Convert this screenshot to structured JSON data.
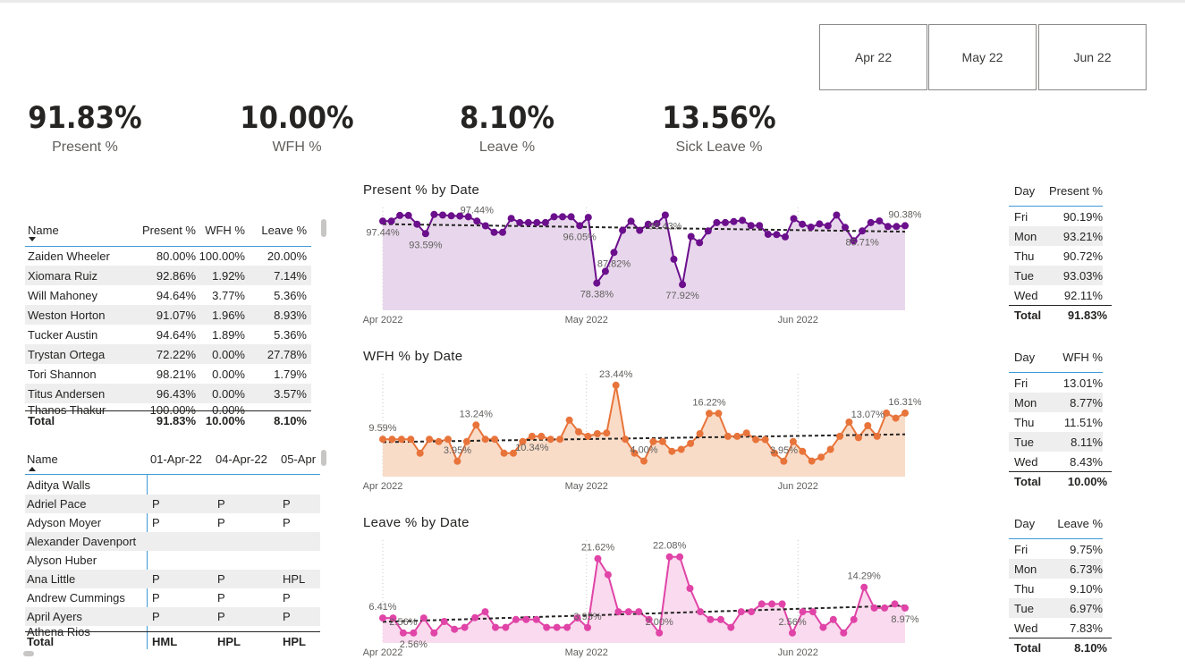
{
  "slicers": [
    "Apr 22",
    "May 22",
    "Jun 22"
  ],
  "kpis": [
    {
      "value": "91.83%",
      "label": "Present %"
    },
    {
      "value": "10.00%",
      "label": "WFH %"
    },
    {
      "value": "8.10%",
      "label": "Leave %"
    },
    {
      "value": "13.56%",
      "label": "Sick Leave %"
    }
  ],
  "employee_table": {
    "columns": [
      "Name",
      "Present %",
      "WFH %",
      "Leave %"
    ],
    "rows": [
      [
        "Zaiden Wheeler",
        "80.00%",
        "100.00%",
        "20.00%"
      ],
      [
        "Xiomara Ruiz",
        "92.86%",
        "1.92%",
        "7.14%"
      ],
      [
        "Will Mahoney",
        "94.64%",
        "3.77%",
        "5.36%"
      ],
      [
        "Weston Horton",
        "91.07%",
        "1.96%",
        "8.93%"
      ],
      [
        "Tucker Austin",
        "94.64%",
        "1.89%",
        "5.36%"
      ],
      [
        "Trystan Ortega",
        "72.22%",
        "0.00%",
        "27.78%"
      ],
      [
        "Tori Shannon",
        "98.21%",
        "0.00%",
        "1.79%"
      ],
      [
        "Titus Andersen",
        "96.43%",
        "0.00%",
        "3.57%"
      ],
      [
        "Thanos Thakur",
        "100.00%",
        "0.00%",
        ""
      ]
    ],
    "total": [
      "Total",
      "91.83%",
      "10.00%",
      "8.10%"
    ]
  },
  "attendance_matrix": {
    "columns": [
      "Name",
      "01-Apr-22",
      "04-Apr-22",
      "05-Apr"
    ],
    "rows": [
      [
        "Aditya Walls",
        "",
        "",
        ""
      ],
      [
        "Adriel Pace",
        "P",
        "P",
        "P"
      ],
      [
        "Adyson Moyer",
        "P",
        "P",
        "P"
      ],
      [
        "Alexander Davenport",
        "",
        "",
        ""
      ],
      [
        "Alyson Huber",
        "",
        "",
        ""
      ],
      [
        "Ana Little",
        "P",
        "P",
        "HPL"
      ],
      [
        "Andrew Cummings",
        "P",
        "P",
        "P"
      ],
      [
        "April Ayers",
        "P",
        "P",
        "P"
      ],
      [
        "Athena Rios",
        "",
        "",
        ""
      ]
    ],
    "total": [
      "Total",
      "HML",
      "HPL",
      "HPL"
    ]
  },
  "colors": {
    "present": "#6b0f8c",
    "present_fill": "#e8d7ec",
    "wfh": "#e8743b",
    "wfh_fill": "#f9dcc8",
    "leave": "#e044a7",
    "leave_fill": "#fadaee",
    "accent_line": "#3e9ad7"
  },
  "chart_data": [
    {
      "type": "line",
      "title": "Present % by Date",
      "x_ticks": [
        "Apr 2022",
        "May 2022",
        "Jun 2022"
      ],
      "ylim": [
        70,
        100
      ],
      "values": [
        97.44,
        97.44,
        99.2,
        99.2,
        96.5,
        93.59,
        99.5,
        99.3,
        99.1,
        99,
        98.8,
        97.44,
        96,
        94,
        94,
        98.3,
        97,
        97,
        97,
        97,
        98.8,
        98.8,
        98.8,
        96.05,
        98.6,
        78.38,
        82,
        87.82,
        94.6,
        97.4,
        94.6,
        96.5,
        96.7,
        99.3,
        85.71,
        77.92,
        92.7,
        90.8,
        94.4,
        97,
        97,
        97.3,
        97.7,
        96.1,
        96.1,
        93.4,
        93.3,
        92.6,
        98.2,
        96.5,
        95.6,
        96.6,
        96,
        99.3,
        95.5,
        91.4,
        94.4,
        97,
        97.5,
        95.8,
        95.8,
        96.05
      ],
      "labels": [
        {
          "text": "97.44%"
        },
        {
          "text": "93.59%"
        },
        {
          "text": "97.44%"
        },
        {
          "text": "87.82%"
        },
        {
          "text": "96.05%"
        },
        {
          "text": "78.38%"
        },
        {
          "text": "96.43%"
        },
        {
          "text": "77.92%"
        },
        {
          "text": "85.71%"
        },
        {
          "text": "90.38%"
        }
      ]
    },
    {
      "type": "line",
      "title": "WFH % by Date",
      "x_ticks": [
        "Apr 2022",
        "May 2022",
        "Jun 2022"
      ],
      "ylim": [
        0,
        25
      ],
      "values": [
        9.59,
        9.59,
        9.59,
        9.59,
        6.0,
        9.59,
        9.0,
        9.59,
        3.95,
        9.0,
        13.24,
        9.59,
        9.59,
        6.0,
        6.0,
        9.0,
        10.34,
        10.34,
        9.59,
        9.59,
        14.5,
        11.5,
        10.34,
        11.0,
        11.2,
        23.44,
        9.59,
        6.0,
        4.0,
        9.0,
        9.0,
        6.5,
        7.0,
        8.5,
        11.0,
        16.22,
        16.22,
        10.34,
        10.34,
        11.2,
        9.5,
        9.5,
        6.0,
        3.95,
        9.0,
        6.5,
        4.0,
        5.0,
        7.0,
        10.34,
        14.0,
        10.0,
        13.07,
        10.34,
        16.31,
        15.0,
        16.31
      ],
      "labels": [
        {
          "text": "9.59%"
        },
        {
          "text": "3.95%"
        },
        {
          "text": "13.24%"
        },
        {
          "text": "10.34%"
        },
        {
          "text": "23.44%"
        },
        {
          "text": "4.00%"
        },
        {
          "text": "16.22%"
        },
        {
          "text": "3.95%"
        },
        {
          "text": "13.07%"
        },
        {
          "text": "16.31%"
        }
      ]
    },
    {
      "type": "line",
      "title": "Leave % by Date",
      "x_ticks": [
        "Apr 2022",
        "May 2022",
        "Jun 2022"
      ],
      "ylim": [
        0,
        25
      ],
      "values": [
        6.41,
        6.41,
        2.56,
        2.56,
        6.41,
        2.56,
        5.5,
        3.5,
        4.0,
        6.5,
        8.0,
        4.0,
        4.0,
        6.0,
        6.0,
        6.0,
        4.0,
        4.0,
        4.0,
        6.41,
        3.95,
        21.62,
        17.5,
        8.0,
        8.0,
        8.0,
        6.0,
        2.56,
        22.08,
        22.08,
        14.0,
        8.0,
        6.0,
        6.0,
        4.0,
        8.0,
        8.0,
        10.0,
        10.0,
        10.0,
        2.56,
        8.0,
        8.0,
        4.0,
        6.0,
        2.56,
        6.0,
        14.29,
        8.97,
        8.97,
        10.0,
        8.97
      ],
      "labels": [
        {
          "text": "6.41%"
        },
        {
          "text": "2.56%"
        },
        {
          "text": "2.56%"
        },
        {
          "text": "3.95%"
        },
        {
          "text": "21.62%"
        },
        {
          "text": "2.00%"
        },
        {
          "text": "22.08%"
        },
        {
          "text": "2.56%"
        },
        {
          "text": "14.29%"
        },
        {
          "text": "8.97%"
        }
      ]
    }
  ],
  "day_tables": [
    {
      "columns": [
        "Day",
        "Present %"
      ],
      "rows": [
        [
          "Fri",
          "90.19%"
        ],
        [
          "Mon",
          "93.21%"
        ],
        [
          "Thu",
          "90.72%"
        ],
        [
          "Tue",
          "93.03%"
        ],
        [
          "Wed",
          "92.11%"
        ]
      ],
      "total": [
        "Total",
        "91.83%"
      ]
    },
    {
      "columns": [
        "Day",
        "WFH %"
      ],
      "rows": [
        [
          "Fri",
          "13.01%"
        ],
        [
          "Mon",
          "8.77%"
        ],
        [
          "Thu",
          "11.51%"
        ],
        [
          "Tue",
          "8.11%"
        ],
        [
          "Wed",
          "8.43%"
        ]
      ],
      "total": [
        "Total",
        "10.00%"
      ]
    },
    {
      "columns": [
        "Day",
        "Leave %"
      ],
      "rows": [
        [
          "Fri",
          "9.75%"
        ],
        [
          "Mon",
          "6.73%"
        ],
        [
          "Thu",
          "9.10%"
        ],
        [
          "Tue",
          "6.97%"
        ],
        [
          "Wed",
          "7.83%"
        ]
      ],
      "total": [
        "Total",
        "8.10%"
      ]
    }
  ]
}
